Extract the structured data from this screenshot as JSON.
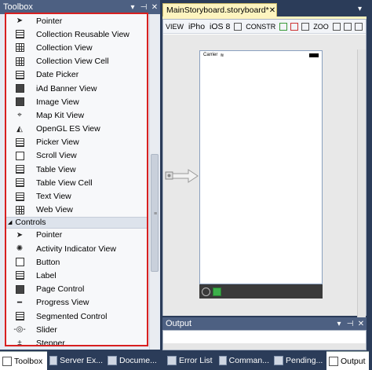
{
  "toolbox": {
    "title": "Toolbox",
    "buttons": [
      "▾",
      "⊣",
      "✕"
    ],
    "items": [
      {
        "label": "Pointer",
        "icon": "pointer-icon"
      },
      {
        "label": "Collection Reusable View",
        "icon": "collection-reusable-view-icon"
      },
      {
        "label": "Collection View",
        "icon": "collection-view-icon"
      },
      {
        "label": "Collection View Cell",
        "icon": "collection-view-cell-icon"
      },
      {
        "label": "Date Picker",
        "icon": "date-picker-icon"
      },
      {
        "label": "iAd Banner View",
        "icon": "iad-banner-view-icon"
      },
      {
        "label": "Image View",
        "icon": "image-view-icon"
      },
      {
        "label": "Map Kit View",
        "icon": "map-kit-view-icon"
      },
      {
        "label": "OpenGL ES View",
        "icon": "opengl-es-view-icon"
      },
      {
        "label": "Picker View",
        "icon": "picker-view-icon"
      },
      {
        "label": "Scroll View",
        "icon": "scroll-view-icon"
      },
      {
        "label": "Table View",
        "icon": "table-view-icon"
      },
      {
        "label": "Table View Cell",
        "icon": "table-view-cell-icon"
      },
      {
        "label": "Text View",
        "icon": "text-view-icon"
      },
      {
        "label": "Web View",
        "icon": "web-view-icon"
      }
    ],
    "group_controls": "Controls",
    "controls": [
      {
        "label": "Pointer",
        "icon": "pointer-icon"
      },
      {
        "label": "Activity Indicator View",
        "icon": "activity-indicator-icon"
      },
      {
        "label": "Button",
        "icon": "button-icon"
      },
      {
        "label": "Label",
        "icon": "label-icon"
      },
      {
        "label": "Page Control",
        "icon": "page-control-icon"
      },
      {
        "label": "Progress View",
        "icon": "progress-view-icon"
      },
      {
        "label": "Segmented Control",
        "icon": "segmented-control-icon"
      },
      {
        "label": "Slider",
        "icon": "slider-icon"
      },
      {
        "label": "Stepper",
        "icon": "stepper-icon"
      }
    ]
  },
  "editor": {
    "tab_title": "MainStoryboard.storyboard*",
    "tab_close": "✕",
    "tab_dropdown": "▾",
    "toolbar": {
      "view_label": "VIEW",
      "device_label": "iPho",
      "os_label": "iOS 8",
      "constraints_label": "CONSTR",
      "zoom_label": "ZOO"
    },
    "phone": {
      "carrier": "Carrier"
    }
  },
  "output": {
    "title": "Output",
    "buttons": [
      "▾",
      "⊣",
      "✕"
    ]
  },
  "bottom_tabs": [
    {
      "label": "Toolbox",
      "active": true
    },
    {
      "label": "Server Ex...",
      "active": false
    },
    {
      "label": "Docume...",
      "active": false
    },
    {
      "label": "Error List",
      "active": false
    },
    {
      "label": "Comman...",
      "active": false
    },
    {
      "label": "Pending...",
      "active": false
    },
    {
      "label": "Output",
      "active": true
    }
  ],
  "colors": {
    "title_bar": "#4d6082",
    "background": "#2b3c59",
    "selection_border": "#d82020",
    "doc_tab": "#fdf4bf"
  }
}
